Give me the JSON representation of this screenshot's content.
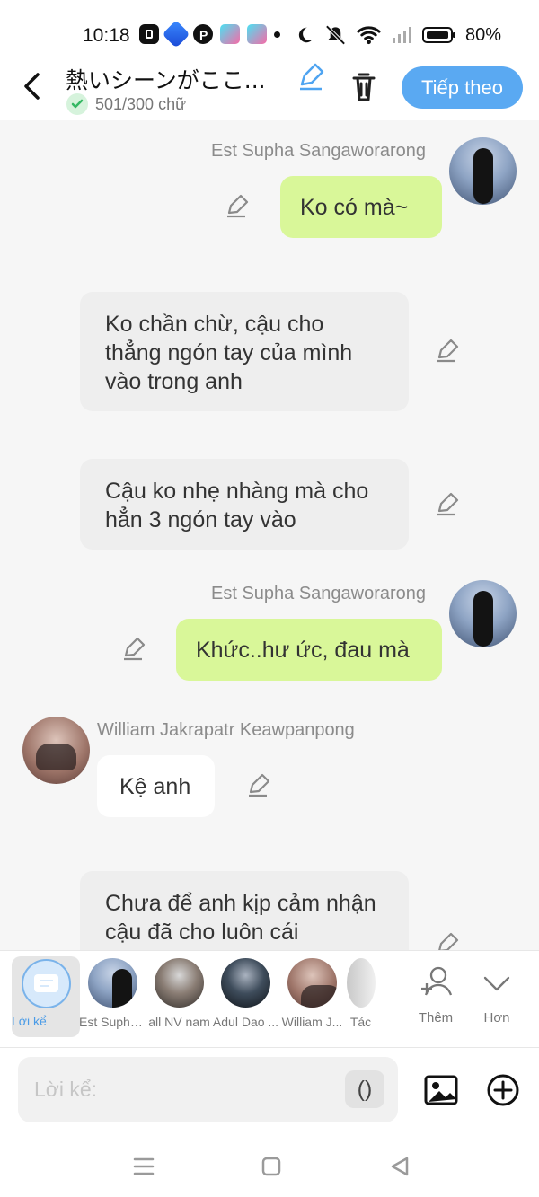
{
  "status_bar": {
    "time": "10:18",
    "battery": "80%",
    "icons": [
      "cast-app-icon",
      "browser-app-icon",
      "pinterest-app-icon",
      "shopping-app-icon",
      "shopping-app-icon",
      "dot-icon",
      "moon-icon",
      "bell-off-icon",
      "wifi-icon",
      "signal-icon",
      "battery-icon"
    ]
  },
  "header": {
    "title": "熱いシーンがここ...",
    "counter": "501/300 chữ",
    "next_label": "Tiếp theo"
  },
  "messages": [
    {
      "speaker": "Est Supha Sangaworarong",
      "text": "Ko có mà~"
    },
    {
      "speaker": "",
      "text": "Ko chần chừ, cậu cho thẳng ngón tay của mình vào trong anh"
    },
    {
      "speaker": "",
      "text": "Cậu ko nhẹ nhàng mà cho hẳn 3 ngón tay vào"
    },
    {
      "speaker": "Est Supha Sangaworarong",
      "text": "Khức..hư ức, đau mà"
    },
    {
      "speaker": "William Jakrapatr Keawpanpong",
      "text": "Kệ anh"
    },
    {
      "speaker": "",
      "text": "Chưa để anh kịp cảm nhận cậu đã cho luôn cái"
    }
  ],
  "characters": {
    "narration": "Lời kể",
    "items": [
      "Est Supha...",
      "all NV nam",
      "Adul Dao ...",
      "William J...",
      "Tác"
    ],
    "more": "Thêm",
    "less": "Hơn"
  },
  "composer": {
    "placeholder": "Lời kể:",
    "paren_label": "()"
  },
  "colors": {
    "accent": "#5AA9F2",
    "green_bubble": "#D9F799",
    "gray_bubble": "#EEEEEE",
    "success": "#35B863"
  }
}
